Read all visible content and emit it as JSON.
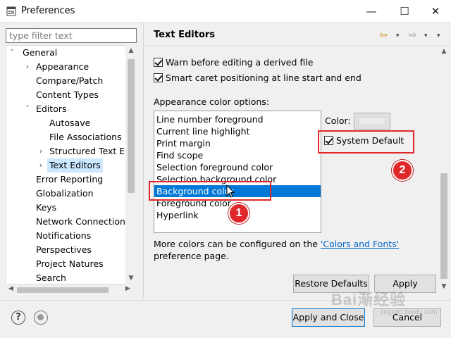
{
  "window": {
    "title": "Preferences",
    "minimize": "—",
    "maximize": "☐",
    "close": "✕"
  },
  "filter": {
    "placeholder": "type filter text",
    "value": ""
  },
  "tree": {
    "items": [
      {
        "label": "General",
        "twisty": "˅"
      },
      {
        "label": "Appearance",
        "twisty": "›"
      },
      {
        "label": "Compare/Patch",
        "twisty": ""
      },
      {
        "label": "Content Types",
        "twisty": ""
      },
      {
        "label": "Editors",
        "twisty": "˅"
      },
      {
        "label": "Autosave",
        "twisty": ""
      },
      {
        "label": "File Associations",
        "twisty": ""
      },
      {
        "label": "Structured Text Ed",
        "twisty": "›"
      },
      {
        "label": "Text Editors",
        "twisty": "›"
      },
      {
        "label": "Error Reporting",
        "twisty": ""
      },
      {
        "label": "Globalization",
        "twisty": ""
      },
      {
        "label": "Keys",
        "twisty": ""
      },
      {
        "label": "Network Connections",
        "twisty": ""
      },
      {
        "label": "Notifications",
        "twisty": ""
      },
      {
        "label": "Perspectives",
        "twisty": ""
      },
      {
        "label": "Project Natures",
        "twisty": ""
      },
      {
        "label": "Search",
        "twisty": ""
      }
    ]
  },
  "page": {
    "title": "Text Editors",
    "nav_back": "⇦",
    "nav_fwd": "⇨",
    "dropdown": "▾"
  },
  "checks": {
    "warn_derived": "Warn before editing a derived file",
    "smart_caret": "Smart caret positioning at line start and end"
  },
  "appearance": {
    "label": "Appearance color options:",
    "items": [
      "Line number foreground",
      "Current line highlight",
      "Print margin",
      "Find scope",
      "Selection foreground color",
      "Selection background color",
      "Background color",
      "Foreground color",
      "Hyperlink"
    ],
    "selected_index": 6,
    "color_label": "Color:",
    "system_default": "System Default"
  },
  "info": {
    "prefix": "More colors can be configured on the ",
    "link": "'Colors and Fonts'",
    "suffix": " preference page."
  },
  "buttons": {
    "restore": "Restore Defaults",
    "apply": "Apply",
    "apply_close": "Apply and Close",
    "cancel": "Cancel"
  },
  "footer": {
    "help": "?"
  },
  "annotations": {
    "one": "1",
    "two": "2"
  },
  "watermark": {
    "text": "Bai渐经验",
    "sub": "jingyan.baidu.com"
  },
  "colors": {
    "accent": "#0078d7",
    "annotation": "#e0282a",
    "link": "#0066cc"
  }
}
